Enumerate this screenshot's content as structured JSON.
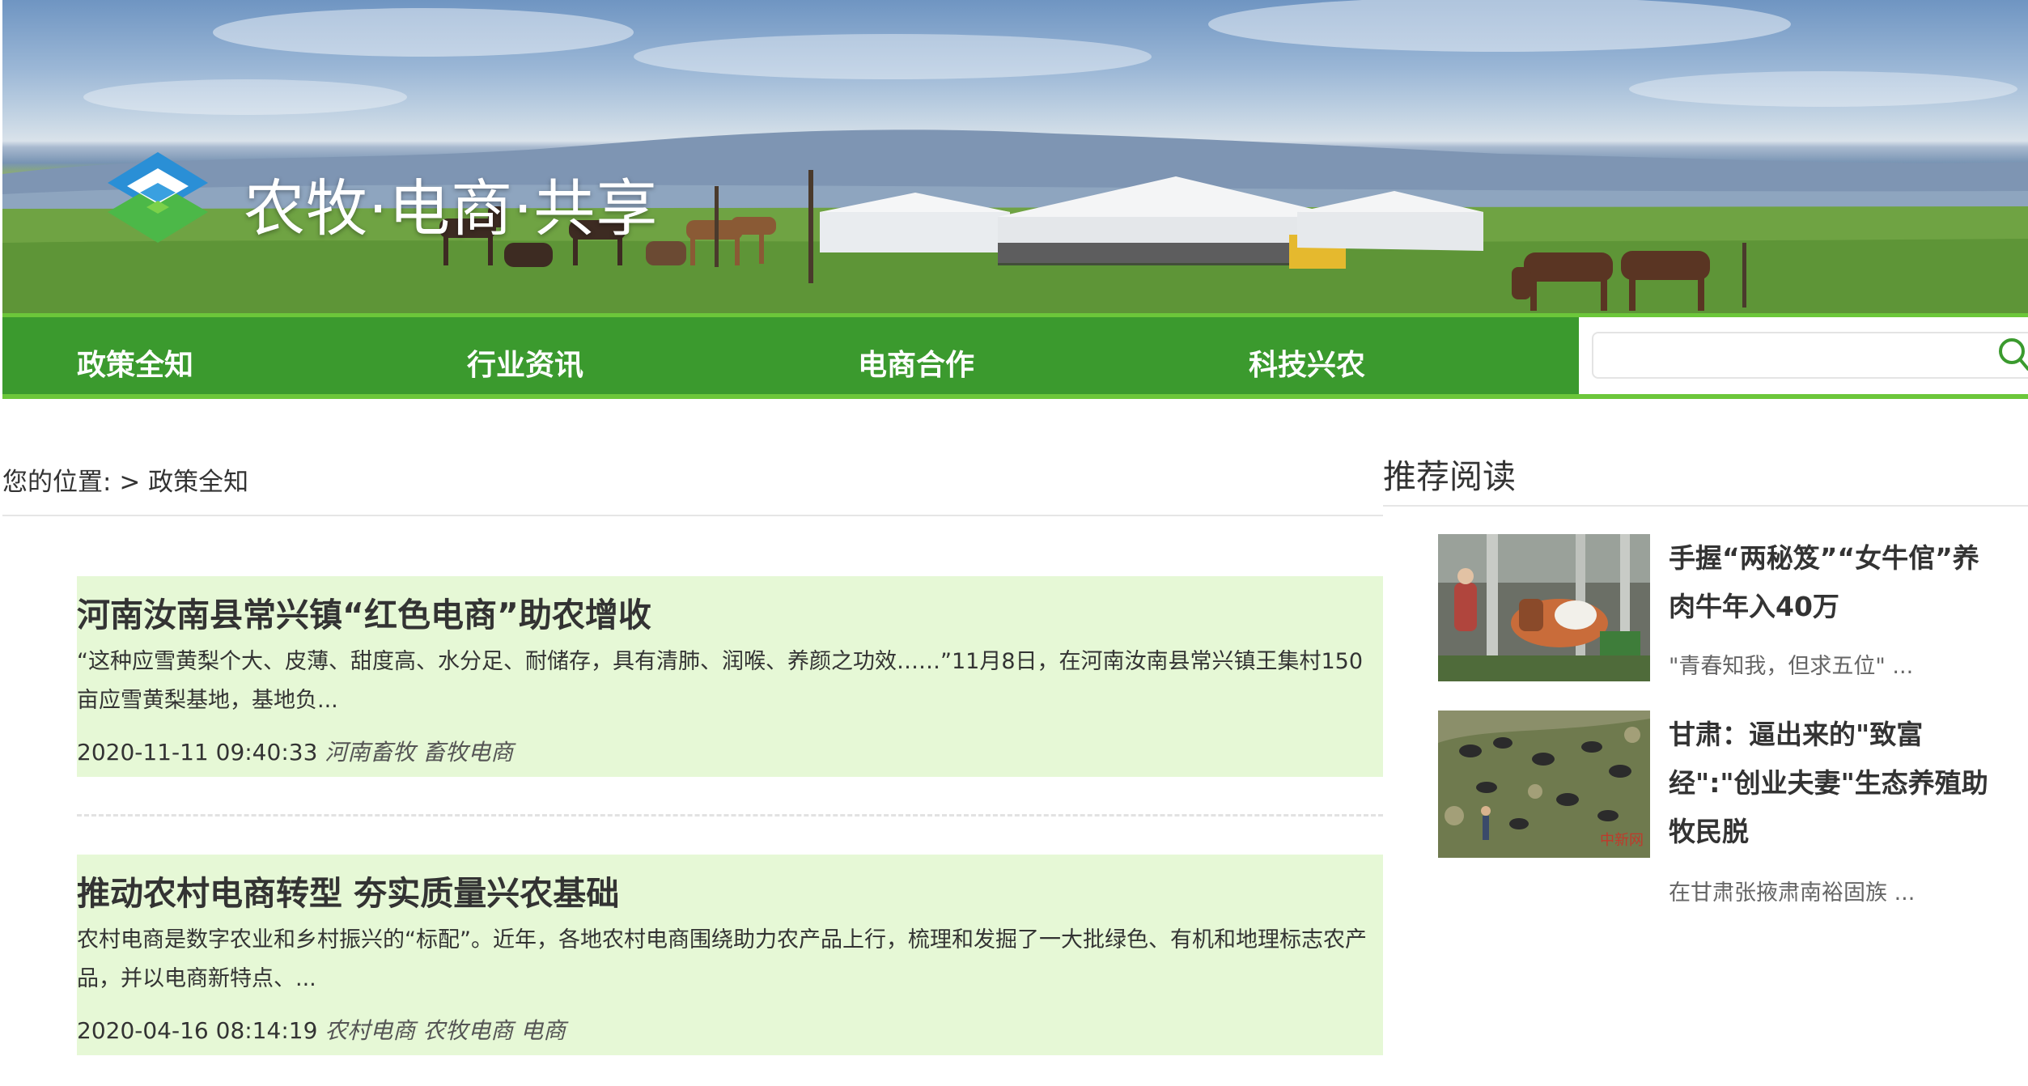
{
  "site": {
    "title": "农牧·电商·共享"
  },
  "nav": {
    "items": [
      {
        "label": "政策全知"
      },
      {
        "label": "行业资讯"
      },
      {
        "label": "电商合作"
      },
      {
        "label": "科技兴农"
      }
    ],
    "search_placeholder": ""
  },
  "breadcrumb": {
    "prefix": "您的位置:",
    "separator": ">",
    "current": "政策全知"
  },
  "articles": [
    {
      "title": "河南汝南县常兴镇“红色电商”助农增收",
      "summary": "“这种应雪黄梨个大、皮薄、甜度高、水分足、耐储存，具有清肺、润喉、养颜之功效……”11月8日，在河南汝南县常兴镇王集村150亩应雪黄梨基地，基地负...",
      "date": "2020-11-11 09:40:33",
      "tags": "河南畜牧 畜牧电商"
    },
    {
      "title": "推动农村电商转型 夯实质量兴农基础",
      "summary": "农村电商是数字农业和乡村振兴的“标配”。近年，各地农村电商围绕助力农产品上行，梳理和发掘了一大批绿色、有机和地理标志农产品，并以电商新特点、...",
      "date": "2020-04-16 08:14:19",
      "tags": "农村电商 农牧电商 电商"
    }
  ],
  "sidebar": {
    "heading": "推荐阅读",
    "items": [
      {
        "title": "手握“两秘笈”“女牛倌”养肉牛年入40万",
        "summary": "\"青春知我，但求五位\" ..."
      },
      {
        "title": "甘肃：逼出来的\"致富经\":\"创业夫妻\"生态养殖助牧民脱",
        "summary": "在甘肃张掖肃南裕固族 ...",
        "watermark": "中新网"
      }
    ]
  },
  "colors": {
    "nav_green": "#3b9a2e",
    "nav_border": "#6cc73a",
    "article_bg": "#e6f8d6",
    "logo_blue": "#2a8fd6",
    "logo_green": "#4cb848"
  }
}
